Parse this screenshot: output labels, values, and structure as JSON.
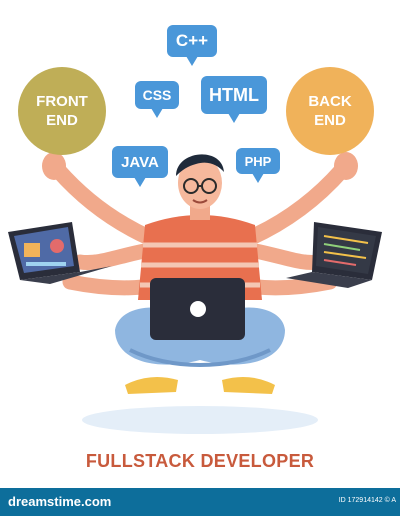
{
  "badges": {
    "front_end": [
      "FRONT",
      "END"
    ],
    "back_end": [
      "BACK",
      "END"
    ]
  },
  "bubbles": {
    "cpp": "C++",
    "css": "CSS",
    "html": "HTML",
    "java": "JAVA",
    "php": "PHP"
  },
  "title": "FULLSTACK DEVELOPER",
  "footer": {
    "brand": "dreamstime.com",
    "image_id": "ID 172914142 © A"
  },
  "colors": {
    "front_end_badge": "#bfae57",
    "back_end_badge": "#f0b25a",
    "bubble": "#4a97d9",
    "title": "#c85a3c",
    "footer": "#0d6e9b"
  }
}
